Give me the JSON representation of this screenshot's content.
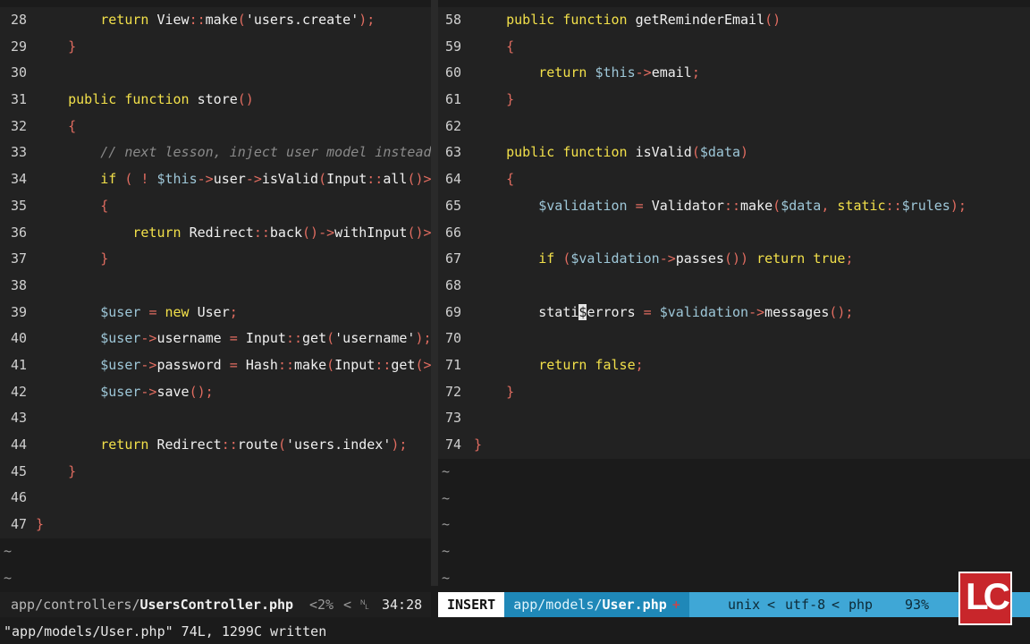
{
  "left_pane": {
    "lines": [
      {
        "n": "28",
        "html": "        <span class=\"k\">return</span> <span class=\"f\">View</span><span class=\"p\">::</span><span class=\"f\">make</span><span class=\"p\">(</span><span class=\"s\">'users.create'</span><span class=\"p\">);</span>"
      },
      {
        "n": "29",
        "html": "    <span class=\"p\">}</span>"
      },
      {
        "n": "30",
        "html": ""
      },
      {
        "n": "31",
        "html": "    <span class=\"k\">public</span> <span class=\"k\">function</span> <span class=\"f\">store</span><span class=\"p\">()</span>"
      },
      {
        "n": "32",
        "html": "    <span class=\"p\">{</span>"
      },
      {
        "n": "33",
        "html": "        <span class=\"c\">// next lesson, inject user model instead</span>"
      },
      {
        "n": "34",
        "html": "        <span class=\"k\">if</span> <span class=\"p\">(</span> <span class=\"p\">!</span> <span class=\"v\">$this</span><span class=\"p\">-></span><span class=\"f\">user</span><span class=\"p\">-></span><span class=\"f\">isValid</span><span class=\"p\">(</span><span class=\"f\">Input</span><span class=\"p\">::</span><span class=\"f\">all</span><span class=\"p\">()></span>"
      },
      {
        "n": "35",
        "html": "        <span class=\"p\">{</span>"
      },
      {
        "n": "36",
        "html": "            <span class=\"k\">return</span> <span class=\"f\">Redirect</span><span class=\"p\">::</span><span class=\"f\">back</span><span class=\"p\">()-></span><span class=\"f\">withInput</span><span class=\"p\">()></span>"
      },
      {
        "n": "37",
        "html": "        <span class=\"p\">}</span>"
      },
      {
        "n": "38",
        "html": ""
      },
      {
        "n": "39",
        "html": "        <span class=\"v\">$user</span> <span class=\"p\">=</span> <span class=\"k\">new</span> <span class=\"f\">User</span><span class=\"p\">;</span>"
      },
      {
        "n": "40",
        "html": "        <span class=\"v\">$user</span><span class=\"p\">-></span><span class=\"f\">username</span> <span class=\"p\">=</span> <span class=\"f\">Input</span><span class=\"p\">::</span><span class=\"f\">get</span><span class=\"p\">(</span><span class=\"s\">'username'</span><span class=\"p\">);</span>"
      },
      {
        "n": "41",
        "html": "        <span class=\"v\">$user</span><span class=\"p\">-></span><span class=\"f\">password</span> <span class=\"p\">=</span> <span class=\"f\">Hash</span><span class=\"p\">::</span><span class=\"f\">make</span><span class=\"p\">(</span><span class=\"f\">Input</span><span class=\"p\">::</span><span class=\"f\">get</span><span class=\"p\">(></span>"
      },
      {
        "n": "42",
        "html": "        <span class=\"v\">$user</span><span class=\"p\">-></span><span class=\"f\">save</span><span class=\"p\">();</span>"
      },
      {
        "n": "43",
        "html": ""
      },
      {
        "n": "44",
        "html": "        <span class=\"k\">return</span> <span class=\"f\">Redirect</span><span class=\"p\">::</span><span class=\"f\">route</span><span class=\"p\">(</span><span class=\"s\">'users.index'</span><span class=\"p\">);</span>"
      },
      {
        "n": "45",
        "html": "    <span class=\"p\">}</span>"
      },
      {
        "n": "46",
        "html": ""
      },
      {
        "n": "47",
        "html": "<span class=\"p\">}</span>"
      }
    ],
    "tildes": [
      "~",
      "~"
    ]
  },
  "right_pane": {
    "lines": [
      {
        "n": "58",
        "html": "    <span class=\"k\">public</span> <span class=\"k\">function</span> <span class=\"f\">getReminderEmail</span><span class=\"p\">()</span>"
      },
      {
        "n": "59",
        "html": "    <span class=\"p\">{</span>"
      },
      {
        "n": "60",
        "html": "        <span class=\"k\">return</span> <span class=\"v\">$this</span><span class=\"p\">-></span><span class=\"f\">email</span><span class=\"p\">;</span>"
      },
      {
        "n": "61",
        "html": "    <span class=\"p\">}</span>"
      },
      {
        "n": "62",
        "html": ""
      },
      {
        "n": "63",
        "html": "    <span class=\"k\">public</span> <span class=\"k\">function</span> <span class=\"f\">isValid</span><span class=\"p\">(</span><span class=\"v\">$data</span><span class=\"p\">)</span>"
      },
      {
        "n": "64",
        "html": "    <span class=\"p\">{</span>"
      },
      {
        "n": "65",
        "html": "        <span class=\"v\">$validation</span> <span class=\"p\">=</span> <span class=\"f\">Validator</span><span class=\"p\">::</span><span class=\"f\">make</span><span class=\"p\">(</span><span class=\"v\">$data</span><span class=\"p\">,</span> <span class=\"k\">static</span><span class=\"p\">::</span><span class=\"v\">$rules</span><span class=\"p\">);</span>"
      },
      {
        "n": "66",
        "html": ""
      },
      {
        "n": "67",
        "html": "        <span class=\"k\">if</span> <span class=\"p\">(</span><span class=\"v\">$validation</span><span class=\"p\">-></span><span class=\"f\">passes</span><span class=\"p\">())</span> <span class=\"k\">return</span> <span class=\"k\">true</span><span class=\"p\">;</span>"
      },
      {
        "n": "68",
        "html": ""
      },
      {
        "n": "69",
        "html": "        <span class=\"f\">stati</span><span class=\"cursor\">$</span><span class=\"f\">errors</span> <span class=\"p\">=</span> <span class=\"v\">$validation</span><span class=\"p\">-></span><span class=\"f\">messages</span><span class=\"p\">();</span>"
      },
      {
        "n": "70",
        "html": ""
      },
      {
        "n": "71",
        "html": "        <span class=\"k\">return</span> <span class=\"k\">false</span><span class=\"p\">;</span>"
      },
      {
        "n": "72",
        "html": "    <span class=\"p\">}</span>"
      },
      {
        "n": "73",
        "html": ""
      },
      {
        "n": "74",
        "html": "<span class=\"p\">}</span>"
      }
    ],
    "tildes": [
      "~",
      "~",
      "~",
      "~",
      "~"
    ]
  },
  "status_left": {
    "path": "app/controllers/",
    "file": "UsersController.php",
    "percent": "<2%",
    "chevron": "<",
    "ln_symbol": "␤",
    "position": "34:28"
  },
  "status_right": {
    "mode": "INSERT",
    "path": "app/models/",
    "file": "User.php",
    "modified": "+",
    "format": "unix",
    "encoding": "utf-8",
    "filetype": "php",
    "percent": "93%",
    "chevron": "<"
  },
  "message": "\"app/models/User.php\" 74L, 1299C written",
  "logo": {
    "text": "LC"
  },
  "colors": {
    "insert_bg": "#ffffff",
    "status_accent": "#3fa7d6",
    "logo": "#c8262b"
  }
}
